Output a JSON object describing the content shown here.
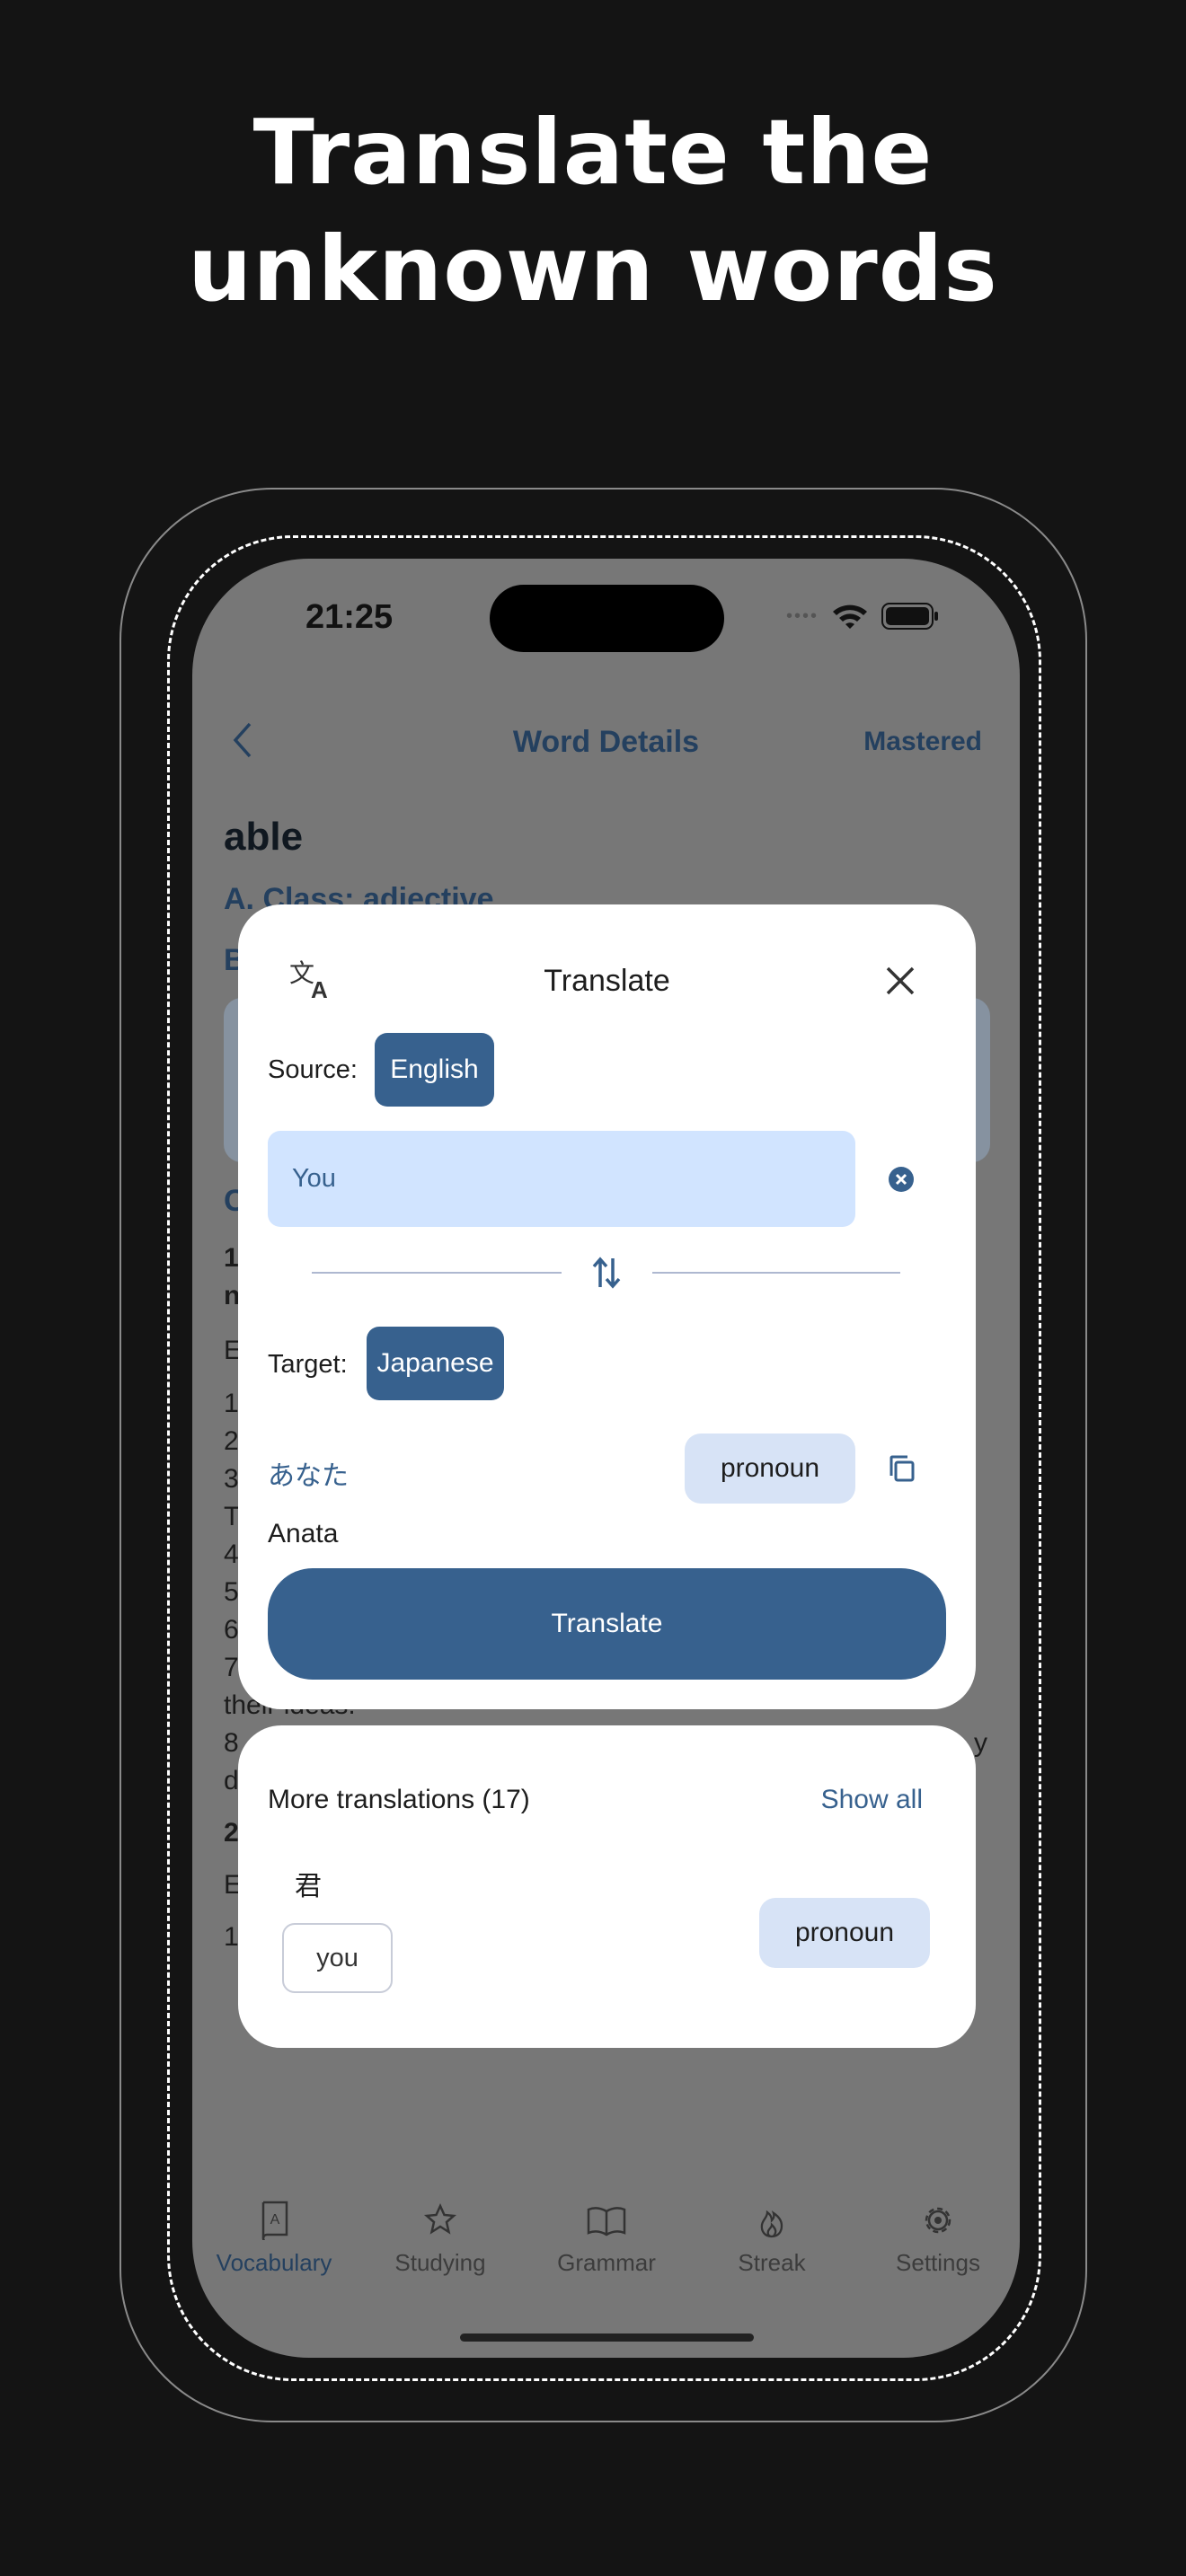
{
  "headline": {
    "line1": "Translate the",
    "line2": "unknown words"
  },
  "status_bar": {
    "time": "21:25"
  },
  "header": {
    "title": "Word Details",
    "action": "Mastered"
  },
  "word": "able",
  "background_fragments": {
    "class_line": "A. Class: adjective",
    "b": "B",
    "c": "C",
    "n1": "1",
    "n": "n",
    "e1": "E",
    "list": [
      "1",
      "2",
      "3",
      "T",
      "4",
      "5",
      "6",
      "7"
    ],
    "ideas": "their ideas.",
    "n8": "8",
    "y": "y",
    "d": "d",
    "n2": "2",
    "e2": "E",
    "n1b": "1"
  },
  "translate_modal": {
    "title": "Translate",
    "source_label": "Source:",
    "source_language": "English",
    "input_value": "You",
    "target_label": "Target:",
    "target_language": "Japanese",
    "result": "あなた",
    "part_of_speech": "pronoun",
    "romanization": "Anata",
    "translate_button": "Translate"
  },
  "more_translations": {
    "title": "More translations (17)",
    "show_all": "Show all",
    "items": [
      {
        "word": "君",
        "meaning": "you",
        "part_of_speech": "pronoun"
      }
    ]
  },
  "tab_bar": {
    "items": [
      {
        "label": "Vocabulary",
        "icon": "vocabulary-book-icon",
        "active": true
      },
      {
        "label": "Studying",
        "icon": "star-icon"
      },
      {
        "label": "Grammar",
        "icon": "open-book-icon"
      },
      {
        "label": "Streak",
        "icon": "flame-icon"
      },
      {
        "label": "Settings",
        "icon": "gear-icon"
      }
    ]
  },
  "colors": {
    "primary": "#37618e",
    "input_bg": "#d1e4ff",
    "chip_bg": "#d7e3f6",
    "overlay": "#777777"
  }
}
